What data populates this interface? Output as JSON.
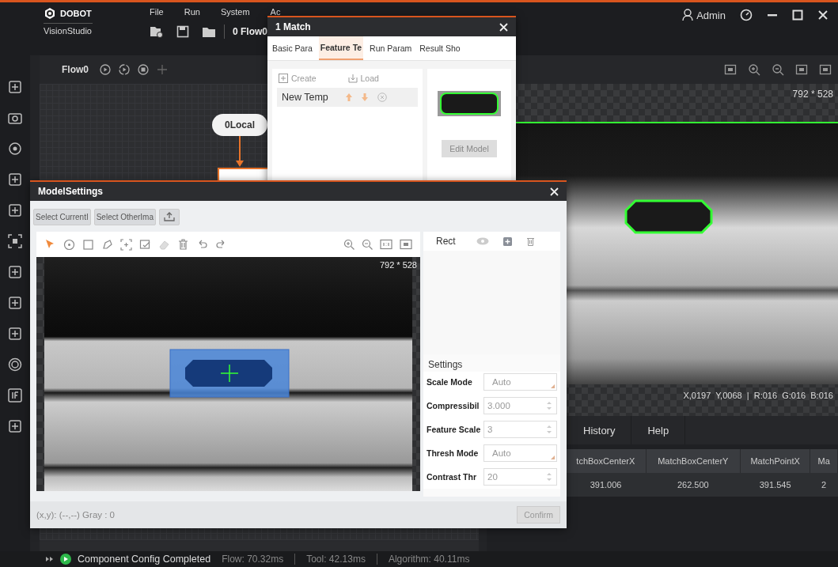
{
  "app": {
    "brand": "DOBOT",
    "product": "VisionStudio"
  },
  "menu": [
    "File",
    "Run",
    "System",
    "Ac"
  ],
  "flow_selector": "0 Flow0",
  "user": {
    "name": "Admin"
  },
  "flow_tab": {
    "label": "Flow0"
  },
  "flow_nodes": [
    {
      "label": "0Local"
    }
  ],
  "image_view": {
    "size": "792 * 528",
    "pixel_info": "X,0197  Y,0068  |  R:016  G:016  B:016"
  },
  "result_tabs": [
    {
      "label": "History",
      "selected": false
    },
    {
      "label": "Help",
      "selected": false
    }
  ],
  "result_table": {
    "columns": [
      "tchBoxCenterX",
      "MatchBoxCenterY",
      "MatchPointX",
      "Ma"
    ],
    "rows": [
      [
        "391.006",
        "262.500",
        "391.545",
        "2"
      ]
    ]
  },
  "status_bar": {
    "message": "Component Config Completed",
    "timings": [
      "Flow: 70.32ms",
      "Tool: 42.13ms",
      "Algorithm: 40.11ms"
    ]
  },
  "match_dialog": {
    "title": "1 Match",
    "tabs": [
      {
        "label": "Basic Para",
        "selected": false
      },
      {
        "label": "Feature Te",
        "selected": true
      },
      {
        "label": "Run Param",
        "selected": false
      },
      {
        "label": "Result Sho",
        "selected": false
      }
    ],
    "create": "Create",
    "load": "Load",
    "templates": [
      {
        "name": "New Temp",
        "selected": true
      }
    ],
    "edit_button": "Edit Model"
  },
  "model_settings": {
    "title": "ModelSettings",
    "buttons": [
      "Select CurrentI",
      "Select OtherIma"
    ],
    "image_size": "792 * 528",
    "shape_header": "Rect",
    "settings_title": "Settings",
    "settings": [
      {
        "label": "Scale Mode",
        "kind": "dropdown",
        "value": "Auto"
      },
      {
        "label": "Compressibil",
        "kind": "spin",
        "value": "3.000"
      },
      {
        "label": "Feature Scale",
        "kind": "spin",
        "value": "3"
      },
      {
        "label": "Thresh Mode",
        "kind": "dropdown",
        "value": "Auto"
      },
      {
        "label": "Contrast Thr",
        "kind": "spin",
        "value": "20"
      }
    ],
    "coords": "(x,y): (--,--) Gray : 0",
    "confirm": "Confirm"
  }
}
